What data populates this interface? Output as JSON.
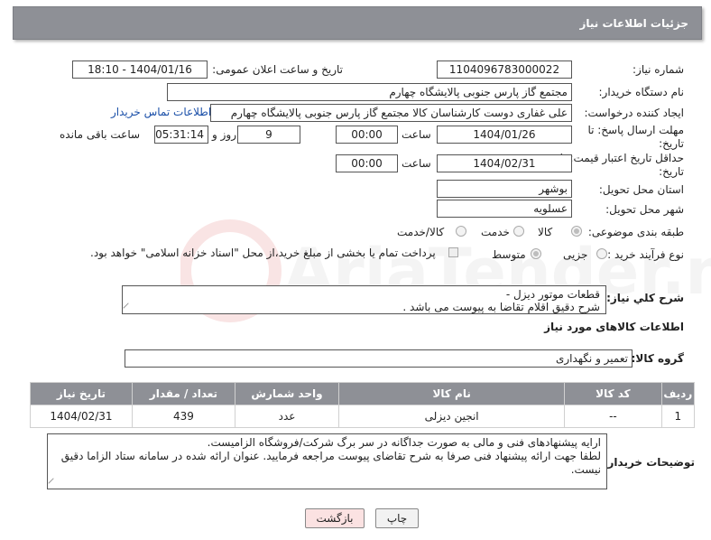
{
  "header": {
    "title": "جزئیات اطلاعات نیاز"
  },
  "form": {
    "need_number_label": "شماره نیاز:",
    "need_number": "1104096783000022",
    "announce_label": "تاریخ و ساعت اعلان عمومی:",
    "announce_value": "1404/01/16 - 18:10",
    "buyer_org_label": "نام دستگاه خریدار:",
    "buyer_org": "مجتمع گاز پارس جنوبی  پالایشگاه چهارم",
    "requester_label": "ایجاد کننده درخواست:",
    "requester": "علی غفاری دوست کارشناسان کالا مجتمع گاز پارس جنوبی  پالایشگاه چهارم",
    "buyer_contact_link": "اطلاعات تماس خریدار",
    "deadline_label": "مهلت ارسال پاسخ: تا تاریخ:",
    "deadline_date": "1404/01/26",
    "time_label": "ساعت",
    "deadline_time": "00:00",
    "days_value": "9",
    "days_label": "روز و",
    "remaining_time": "05:31:14",
    "remaining_label": "ساعت باقی مانده",
    "price_validity_label": "حداقل تاریخ اعتبار قیمت: تا تاریخ:",
    "price_validity_date": "1404/02/31",
    "price_validity_time": "00:00",
    "province_label": "استان محل تحویل:",
    "province": "بوشهر",
    "city_label": "شهر محل تحویل:",
    "city": "عسلویه",
    "category_label": "طبقه بندی موضوعی:",
    "category_options": [
      "کالا",
      "خدمت",
      "کالا/خدمت"
    ],
    "process_label": "نوع فرآیند خرید :",
    "process_options": [
      "جزیی",
      "متوسط"
    ],
    "payment_note": "پرداخت تمام یا بخشی از مبلغ خرید،از محل \"اسناد خزانه اسلامی\" خواهد بود.",
    "summary_label": "شرح کلي نياز:",
    "summary_line1": "قطعات موتور دیزل  -",
    "summary_line2": "شرح دقیق اقلام تقاضا به پیوست می باشد ."
  },
  "goods": {
    "section_title": "اطلاعات کالاهای مورد نیاز",
    "group_label": "گروه کالا:",
    "group_value": "تعمیر و نگهداری",
    "columns": [
      "ردیف",
      "کد کالا",
      "نام کالا",
      "واحد شمارش",
      "تعداد / مقدار",
      "تاریخ نیاز"
    ],
    "rows": [
      {
        "row": "1",
        "code": "--",
        "name": "انجین دیزلی",
        "unit": "عدد",
        "qty": "439",
        "date": "1404/02/31"
      }
    ]
  },
  "notes": {
    "label": "توضیحات خریدار:",
    "line1": "ارایه پیشنهادهای فنی و مالی به صورت جداگانه در سر برگ شرکت/فروشگاه الزامیست.",
    "line2": "لطفا جهت ارائه پیشنهاد فنی صرفا به شرح تقاضای پیوست مراجعه فرمایید. عنوان ارائه شده در سامانه ستاد الزاما دقیق",
    "line3": "نیست."
  },
  "buttons": {
    "print": "چاپ",
    "back": "بازگشت"
  },
  "watermark_text": "AriaTender.neT"
}
